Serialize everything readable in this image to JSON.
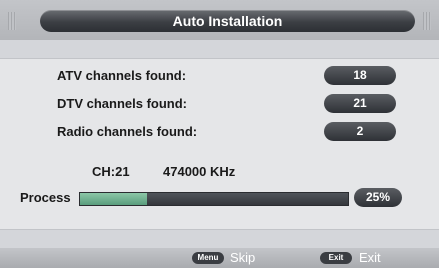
{
  "header": {
    "title": "Auto Installation"
  },
  "rows": [
    {
      "label": "ATV channels found:",
      "value": "18"
    },
    {
      "label": "DTV channels found:",
      "value": "21"
    },
    {
      "label": "Radio channels found:",
      "value": "2"
    }
  ],
  "scan": {
    "channel": "CH:21",
    "frequency": "474000 KHz"
  },
  "progress": {
    "label": "Process",
    "percent_text": "25%",
    "fraction": 0.25
  },
  "footer": {
    "menu_key": "Menu",
    "menu_action": "Skip",
    "exit_key": "Exit",
    "exit_action": "Exit"
  },
  "colors": {
    "progress_fill": "#6fb090",
    "pill": "#2e3136"
  }
}
